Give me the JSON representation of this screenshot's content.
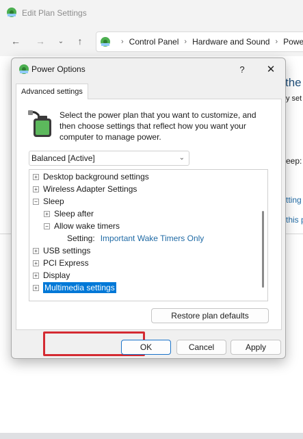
{
  "background_window": {
    "title": "Edit Plan Settings",
    "address": [
      "Control Panel",
      "Hardware and Sound",
      "Powe"
    ],
    "fragments": {
      "heading": "the p",
      "line2": "y set",
      "sleep": "eep:",
      "link1": "tting",
      "link2": "this p"
    }
  },
  "dialog": {
    "title": "Power Options",
    "help_label": "?",
    "close_label": "✕",
    "tab_label": "Advanced settings",
    "intro": "Select the power plan that you want to customize, and then choose settings that reflect how you want your computer to manage power.",
    "plan_selected": "Balanced [Active]",
    "tree": [
      {
        "label": "Desktop background settings",
        "expander": "+",
        "indent": 0
      },
      {
        "label": "Wireless Adapter Settings",
        "expander": "+",
        "indent": 0
      },
      {
        "label": "Sleep",
        "expander": "−",
        "indent": 0
      },
      {
        "label": "Sleep after",
        "expander": "+",
        "indent": 1
      },
      {
        "label": "Allow wake timers",
        "expander": "−",
        "indent": 1
      },
      {
        "label": "Setting:",
        "value": "Important Wake Timers Only",
        "indent": 2
      },
      {
        "label": "USB settings",
        "expander": "+",
        "indent": 0
      },
      {
        "label": "PCI Express",
        "expander": "+",
        "indent": 0
      },
      {
        "label": "Display",
        "expander": "+",
        "indent": 0
      },
      {
        "label": "Multimedia settings",
        "expander": "+",
        "indent": 0,
        "selected": true
      }
    ],
    "restore_label": "Restore plan defaults",
    "ok_label": "OK",
    "cancel_label": "Cancel",
    "apply_label": "Apply"
  },
  "colors": {
    "selection": "#0078d7",
    "highlight_box": "#d42a32",
    "setting_value": "#1f6aa5",
    "link": "#1f6aa5"
  },
  "icons": [
    "control-panel-icon",
    "back-arrow-icon",
    "forward-arrow-icon",
    "chevron-down-icon",
    "up-arrow-icon",
    "battery-icon",
    "help-icon",
    "close-icon"
  ]
}
